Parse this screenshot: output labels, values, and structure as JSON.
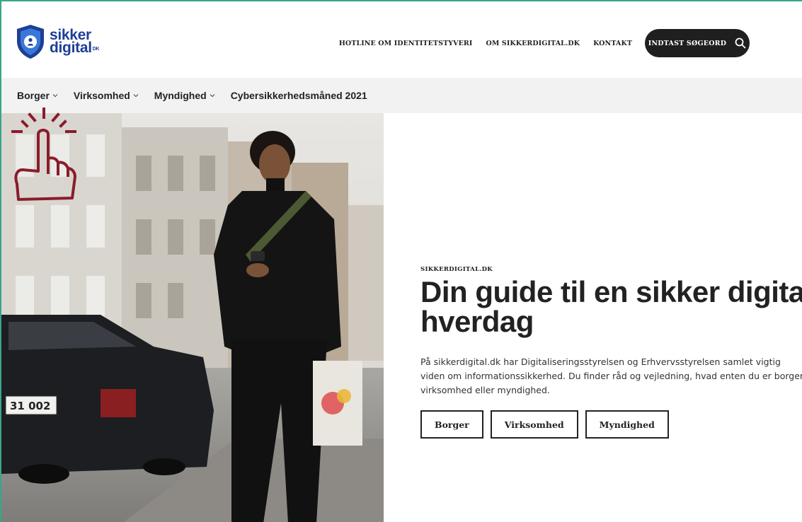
{
  "header": {
    "logo": {
      "line1": "sikker",
      "line2": "digital",
      "suffix": "DK"
    },
    "topnav": [
      {
        "label": "HOTLINE OM IDENTITETSTYVERI"
      },
      {
        "label": "OM SIKKERDIGITAL.DK"
      },
      {
        "label": "KONTAKT"
      }
    ],
    "search": {
      "label": "INDTAST SØGEORD",
      "icon": "search-icon"
    }
  },
  "subnav": [
    {
      "label": "Borger",
      "has_dropdown": true
    },
    {
      "label": "Virksomhed",
      "has_dropdown": true
    },
    {
      "label": "Myndighed",
      "has_dropdown": true
    },
    {
      "label": "Cybersikkerhedsmåned 2021",
      "has_dropdown": false
    }
  ],
  "hero": {
    "eyebrow": "SIKKERDIGITAL.DK",
    "title_line1": "Din guide til en sikker digital",
    "title_line2": "hverdag",
    "lead": "På sikkerdigital.dk har Digitaliseringsstyrelsen og Erhvervsstyrelsen samlet vigtig viden om informationssikkerhed. Du finder råd og vejledning, hvad enten du er borger, virksomhed eller myndighed.",
    "buttons": [
      {
        "label": "Borger"
      },
      {
        "label": "Virksomhed"
      },
      {
        "label": "Myndighed"
      }
    ],
    "license_plate": "31 002"
  },
  "colors": {
    "brand_blue": "#1d3f96",
    "dark": "#1f1f1f",
    "subnav_bg": "#f2f2f2",
    "tap_icon": "#8a1c2b",
    "frame": "#3aa58a"
  }
}
